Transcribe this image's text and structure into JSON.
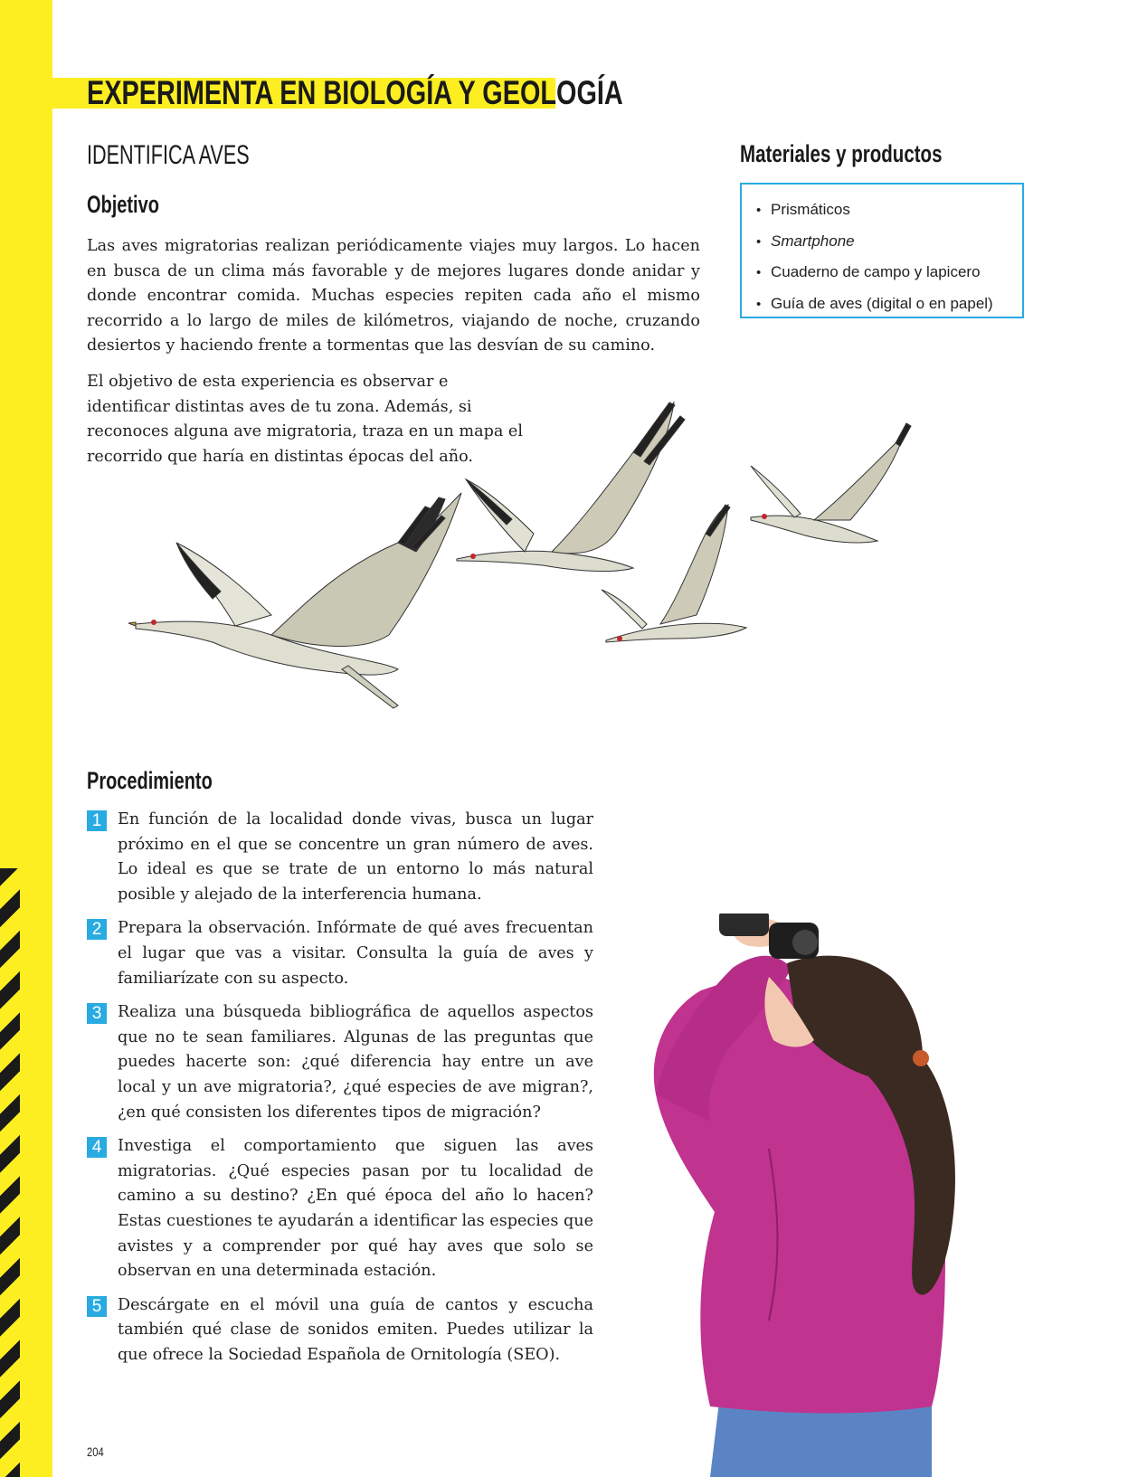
{
  "header": {
    "title": "EXPERIMENTA EN BIOLOGÍA Y GEOLOGÍA"
  },
  "activity": {
    "title": "IDENTIFICA AVES"
  },
  "objetivo": {
    "heading": "Objetivo",
    "paragraphs": [
      "Las aves migratorias realizan periódicamente viajes muy largos. Lo hacen en busca de un clima más favorable y de mejores lugares donde anidar y donde encontrar comida. Muchas especies repiten cada año el mismo recorrido a lo largo de miles de kilómetros, viajando de noche, cruzando desiertos y haciendo frente a tormentas que las desvían de su camino.",
      "El objetivo de esta experiencia es observar e identificar distintas aves de tu zona. Además, si reconoces alguna ave migratoria, traza en un mapa el recorrido que haría en distintas épocas del año."
    ]
  },
  "materiales": {
    "heading": "Materiales y productos",
    "items": [
      "Prismáticos",
      "Smartphone",
      "Cuaderno de campo y lapicero",
      "Guía de aves (digital o en papel)"
    ]
  },
  "procedimiento": {
    "heading": "Procedimiento",
    "steps": [
      {
        "num": "1",
        "text": "En función de la localidad donde vivas, busca un lugar próximo en el que se concentre un gran número de aves. Lo ideal es que se trate de un entorno lo más natural posible y alejado de la interferencia humana."
      },
      {
        "num": "2",
        "text": "Prepara la observación. Infórmate de qué aves frecuentan el lugar que vas a visitar. Consulta la guía de aves y familiarízate con su aspecto."
      },
      {
        "num": "3",
        "text": "Realiza una búsqueda bibliográfica de aquellos aspectos que no te sean familiares. Algunas de las preguntas que puedes hacerte son: ¿qué diferencia hay entre un ave local y un ave migratoria?, ¿qué especies de ave migran?, ¿en qué consisten los diferentes tipos de migración?"
      },
      {
        "num": "4",
        "text": "Investiga el comportamiento que siguen las aves migratorias. ¿Qué especies pasan por tu localidad de camino a su destino? ¿En qué época del año lo hacen? Estas cuestiones te ayudarán a identificar las especies que avistes y a comprender por qué hay aves que solo se observan en una determinada estación."
      },
      {
        "num": "5",
        "text": "Descárgate en el móvil una guía de cantos y escucha también qué clase de sonidos emiten. Puedes utilizar la que ofrece la Sociedad Española de Ornitología (SEO)."
      }
    ]
  },
  "page_number": "204",
  "colors": {
    "accent_yellow": "#fcee21",
    "accent_blue": "#29abe2",
    "jacket": "#c0338f"
  },
  "illustrations": [
    "cranes-flying",
    "girl-with-binoculars"
  ]
}
